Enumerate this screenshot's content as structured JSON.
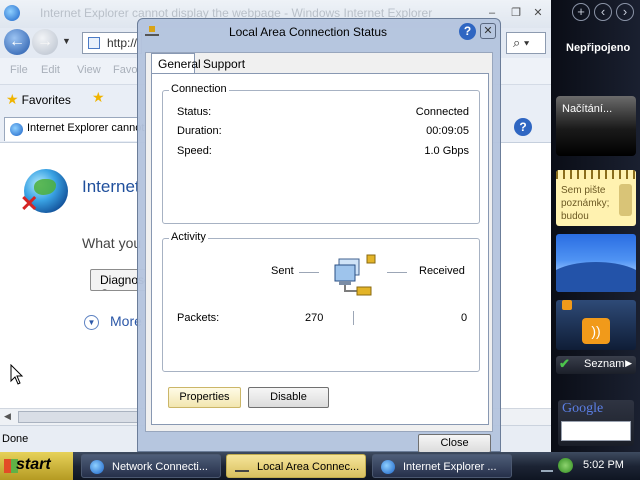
{
  "ie": {
    "window_title": "Internet Explorer cannot display the webpage - Windows Internet Explorer",
    "address_text": "http://",
    "menu": [
      "File",
      "Edit",
      "View",
      "Favo"
    ],
    "favorites_label": "Favorites",
    "tab_title": "Internet Explorer cannot...",
    "error_heading": "Internet Explorer cannot display the webpage",
    "error_what": "What you can try:",
    "diagnose_label": "Diagnose Connection Problems",
    "more_info_label": "More information",
    "status_text": "Done"
  },
  "dialog": {
    "title": "Local Area Connection Status",
    "tabs": [
      "General",
      "Support"
    ],
    "connection_group": "Connection",
    "rows": [
      {
        "label": "Status:",
        "value": "Connected"
      },
      {
        "label": "Duration:",
        "value": "00:09:05"
      },
      {
        "label": "Speed:",
        "value": "1.0 Gbps"
      }
    ],
    "activity_group": "Activity",
    "sent_label": "Sent",
    "received_label": "Received",
    "packets_label": "Packets:",
    "packets_sent": "270",
    "packets_received": "0",
    "properties_button": "Properties",
    "disable_button": "Disable",
    "close_button": "Close"
  },
  "sidebar": {
    "network_status": "Nepřipojeno",
    "loading_text": "Načítání...",
    "notes_text": "Sem pište poznámky; budou",
    "seznam_label": "Seznam",
    "google_label": "Google"
  },
  "taskbar": {
    "start_label": "start",
    "items": [
      "Network Connecti...",
      "Local Area Connec...",
      "Internet Explorer ..."
    ],
    "clock": "5:02 PM"
  }
}
